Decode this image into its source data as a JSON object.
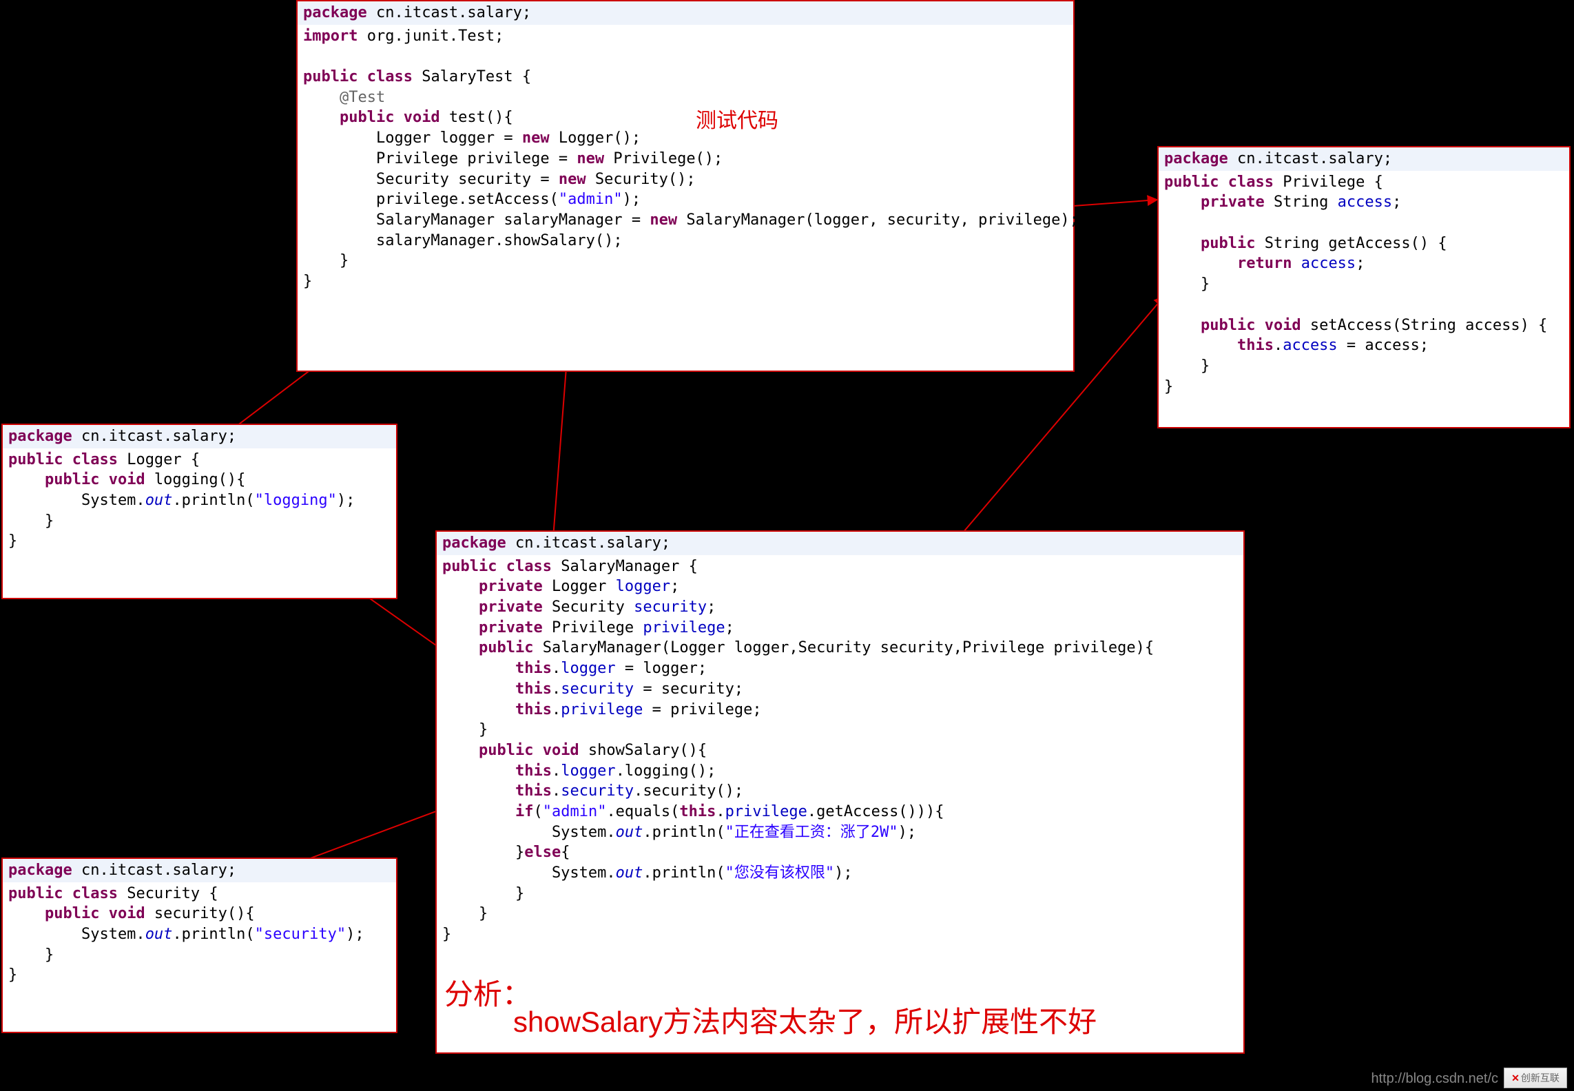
{
  "panels": {
    "salaryTest": {
      "pkg": "package cn.itcast.salary;",
      "imp": "import org.junit.Test;",
      "cls": "public class SalaryTest {",
      "ann": "    @Test",
      "m1": "    public void test(){",
      "b1": "        Logger logger = new Logger();",
      "b2": "        Privilege privilege = new Privilege();",
      "b3": "        Security security = new Security();",
      "b4": "        privilege.setAccess(\"admin\");",
      "b5": "        SalaryManager salaryManager = new SalaryManager(logger, security, privilege);",
      "b6": "        salaryManager.showSalary();",
      "c1": "    }",
      "c2": "}"
    },
    "logger": {
      "pkg": "package cn.itcast.salary;",
      "cls": "public class Logger {",
      "m1": "    public void logging(){",
      "b1": "        System.out.println(\"logging\");",
      "c1": "    }",
      "c2": "}"
    },
    "security": {
      "pkg": "package cn.itcast.salary;",
      "cls": "public class Security {",
      "m1": "    public void security(){",
      "b1": "        System.out.println(\"security\");",
      "c1": "    }",
      "c2": "}"
    },
    "privilege": {
      "pkg": "package cn.itcast.salary;",
      "cls": "public class Privilege {",
      "f1": "    private String access;",
      "m1": "    public String getAccess() {",
      "b1": "        return access;",
      "c1": "    }",
      "m2": "    public void setAccess(String access) {",
      "b2": "        this.access = access;",
      "c2": "    }",
      "c3": "}"
    },
    "salaryManager": {
      "pkg": "package cn.itcast.salary;",
      "cls": "public class SalaryManager {",
      "f1": "    private Logger logger;",
      "f2": "    private Security security;",
      "f3": "    private Privilege privilege;",
      "m1": "    public SalaryManager(Logger logger,Security security,Privilege privilege){",
      "b1": "        this.logger = logger;",
      "b2": "        this.security = security;",
      "b3": "        this.privilege = privilege;",
      "c1": "    }",
      "m2": "    public void showSalary(){",
      "b4": "        this.logger.logging();",
      "b5": "        this.security.security();",
      "b6": "        if(\"admin\".equals(this.privilege.getAccess())){",
      "b7": "            System.out.println(\"正在查看工资：涨了2W\");",
      "b8": "        }else{",
      "b9": "            System.out.println(\"您没有该权限\");",
      "b10": "        }",
      "c2": "    }",
      "c3": "}"
    }
  },
  "annotations": {
    "testLabel": "测试代码",
    "analysisTitle": "分析：",
    "analysisBody": "showSalary方法内容太杂了，所以扩展性不好"
  },
  "footer": {
    "url": "http://blog.csdn.net/c",
    "logo": "创新互联"
  }
}
